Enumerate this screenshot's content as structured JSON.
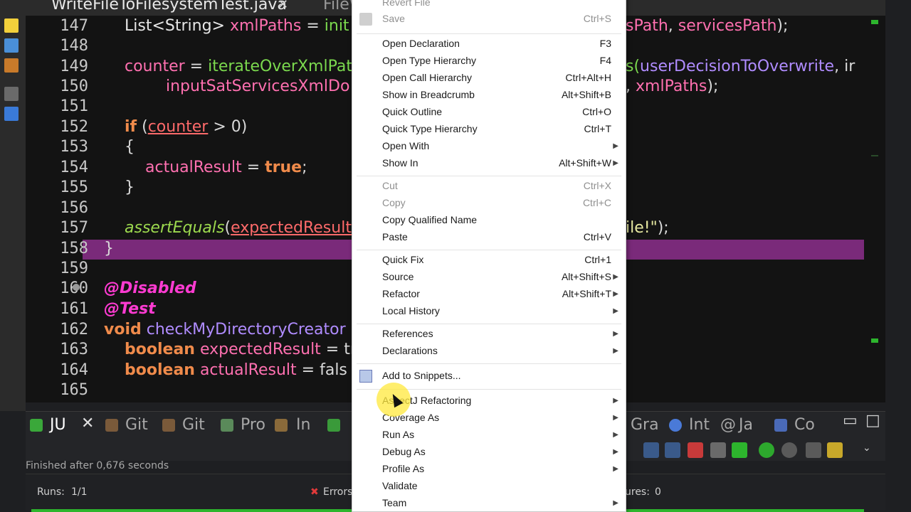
{
  "editor": {
    "tabs": [
      {
        "label": "WriteFileToFilesystemTest.java",
        "active": true
      },
      {
        "label": "FileW",
        "active": false
      }
    ],
    "lines": [
      {
        "num": "147"
      },
      {
        "num": "148"
      },
      {
        "num": "149"
      },
      {
        "num": "150"
      },
      {
        "num": "151"
      },
      {
        "num": "152"
      },
      {
        "num": "153"
      },
      {
        "num": "154"
      },
      {
        "num": "155"
      },
      {
        "num": "156"
      },
      {
        "num": "157"
      },
      {
        "num": "158"
      },
      {
        "num": "159"
      },
      {
        "num": "160"
      },
      {
        "num": "161"
      },
      {
        "num": "162"
      },
      {
        "num": "163"
      },
      {
        "num": "164"
      },
      {
        "num": "165"
      }
    ],
    "code": {
      "l147a": "List<String> ",
      "l147b": "xmlPaths",
      "l147c": " = ",
      "l147d": "init",
      "l147e": "sPath",
      "l147f": ", ",
      "l147g": "servicesPath",
      "l147h": ");",
      "l149a": "counter",
      "l149b": " = ",
      "l149c": "iterateOverXmlPat",
      "l149d": "s(",
      "l149e": "userDecisionToOverwrite",
      "l149f": ", ir",
      "l150a": "inputSatServicesXmlDo",
      "l150b": ", ",
      "l150c": "xmlPaths",
      "l150d": ");",
      "l152a": "if",
      "l152b": " (",
      "l152c": "counter",
      "l152d": " > 0)",
      "l153": "{",
      "l154a": "actualResult",
      "l154b": " = ",
      "l154c": "true",
      "l154d": ";",
      "l155": "}",
      "l157a": "assertEquals",
      "l157b": "(",
      "l157c": "expectedResult",
      "l157d": "ile!\"",
      "l157e": ");",
      "l158": "}",
      "l160": "@Disabled",
      "l161": "@Test",
      "l162a": "void",
      "l162b": " checkMyDirectoryCreator",
      "l163a": "boolean",
      "l163b": " expectedResult",
      "l163c": " = tr",
      "l164a": "boolean",
      "l164b": " actualResult",
      "l164c": " = fals"
    }
  },
  "bottom": {
    "tabs": [
      "JU",
      "Git",
      "Git",
      "Pro",
      "In",
      "Gra",
      "Int",
      "Ja",
      "Co"
    ],
    "status": "Finished after 0,676 seconds",
    "runs_label": "Runs:",
    "runs_value": "1/1",
    "errors_label": "Errors",
    "failures_label": "ures:",
    "failures_value": "0"
  },
  "context_menu": {
    "items": [
      {
        "label": "Revert File",
        "shortcut": "",
        "disabled": true
      },
      {
        "label": "Save",
        "shortcut": "Ctrl+S",
        "disabled": true
      },
      {
        "label": "Open Declaration",
        "shortcut": "F3"
      },
      {
        "label": "Open Type Hierarchy",
        "shortcut": "F4"
      },
      {
        "label": "Open Call Hierarchy",
        "shortcut": "Ctrl+Alt+H"
      },
      {
        "label": "Show in Breadcrumb",
        "shortcut": "Alt+Shift+B"
      },
      {
        "label": "Quick Outline",
        "shortcut": "Ctrl+O"
      },
      {
        "label": "Quick Type Hierarchy",
        "shortcut": "Ctrl+T"
      },
      {
        "label": "Open With",
        "shortcut": "",
        "submenu": true
      },
      {
        "label": "Show In",
        "shortcut": "Alt+Shift+W",
        "submenu": true
      },
      {
        "label": "Cut",
        "shortcut": "Ctrl+X",
        "disabled": true
      },
      {
        "label": "Copy",
        "shortcut": "Ctrl+C",
        "disabled": true
      },
      {
        "label": "Copy Qualified Name",
        "shortcut": ""
      },
      {
        "label": "Paste",
        "shortcut": "Ctrl+V"
      },
      {
        "label": "Quick Fix",
        "shortcut": "Ctrl+1"
      },
      {
        "label": "Source",
        "shortcut": "Alt+Shift+S",
        "submenu": true
      },
      {
        "label": "Refactor",
        "shortcut": "Alt+Shift+T",
        "submenu": true
      },
      {
        "label": "Local History",
        "shortcut": "",
        "submenu": true
      },
      {
        "label": "References",
        "shortcut": "",
        "submenu": true
      },
      {
        "label": "Declarations",
        "shortcut": "",
        "submenu": true
      },
      {
        "label": "Add to Snippets...",
        "shortcut": ""
      },
      {
        "label": "AspectJ Refactoring",
        "shortcut": "",
        "submenu": true
      },
      {
        "label": "Coverage As",
        "shortcut": "",
        "submenu": true
      },
      {
        "label": "Run As",
        "shortcut": "",
        "submenu": true
      },
      {
        "label": "Debug As",
        "shortcut": "",
        "submenu": true
      },
      {
        "label": "Profile As",
        "shortcut": "",
        "submenu": true
      },
      {
        "label": "Validate",
        "shortcut": ""
      },
      {
        "label": "Team",
        "shortcut": "",
        "submenu": true
      }
    ]
  },
  "colors": {
    "highlight": "#7a2a7a",
    "progress": "#2db52d"
  }
}
